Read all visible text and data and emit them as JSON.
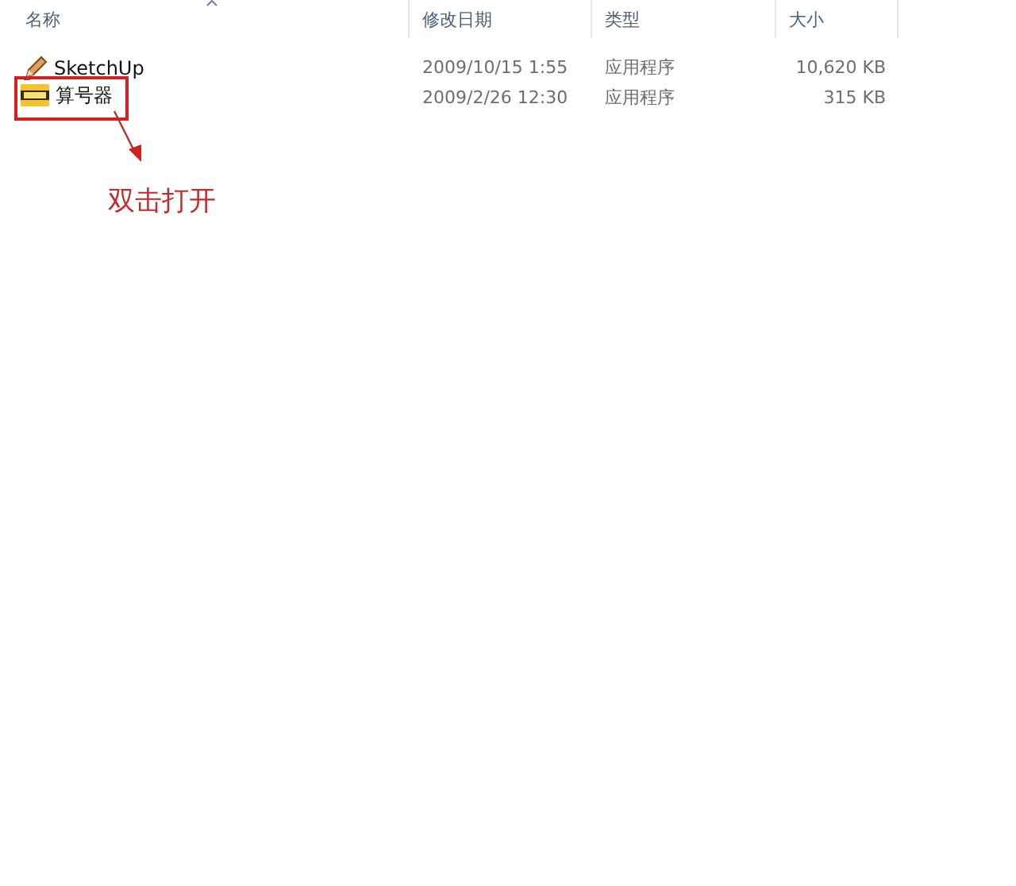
{
  "table": {
    "columns": [
      "名称",
      "修改日期",
      "类型",
      "大小"
    ],
    "rows": [
      {
        "name": "SketchUp",
        "kind": "sketch",
        "highlighted": false,
        "date": "2009/10/15 1:55",
        "type": "应用程序",
        "size": "10,620 KB"
      },
      {
        "name": "算号器",
        "kind": "keygen",
        "highlighted": true,
        "date": "2009/2/26 12:30",
        "type": "应用程序",
        "size": "315 KB"
      }
    ]
  },
  "annotation": {
    "text": "双击打开"
  }
}
